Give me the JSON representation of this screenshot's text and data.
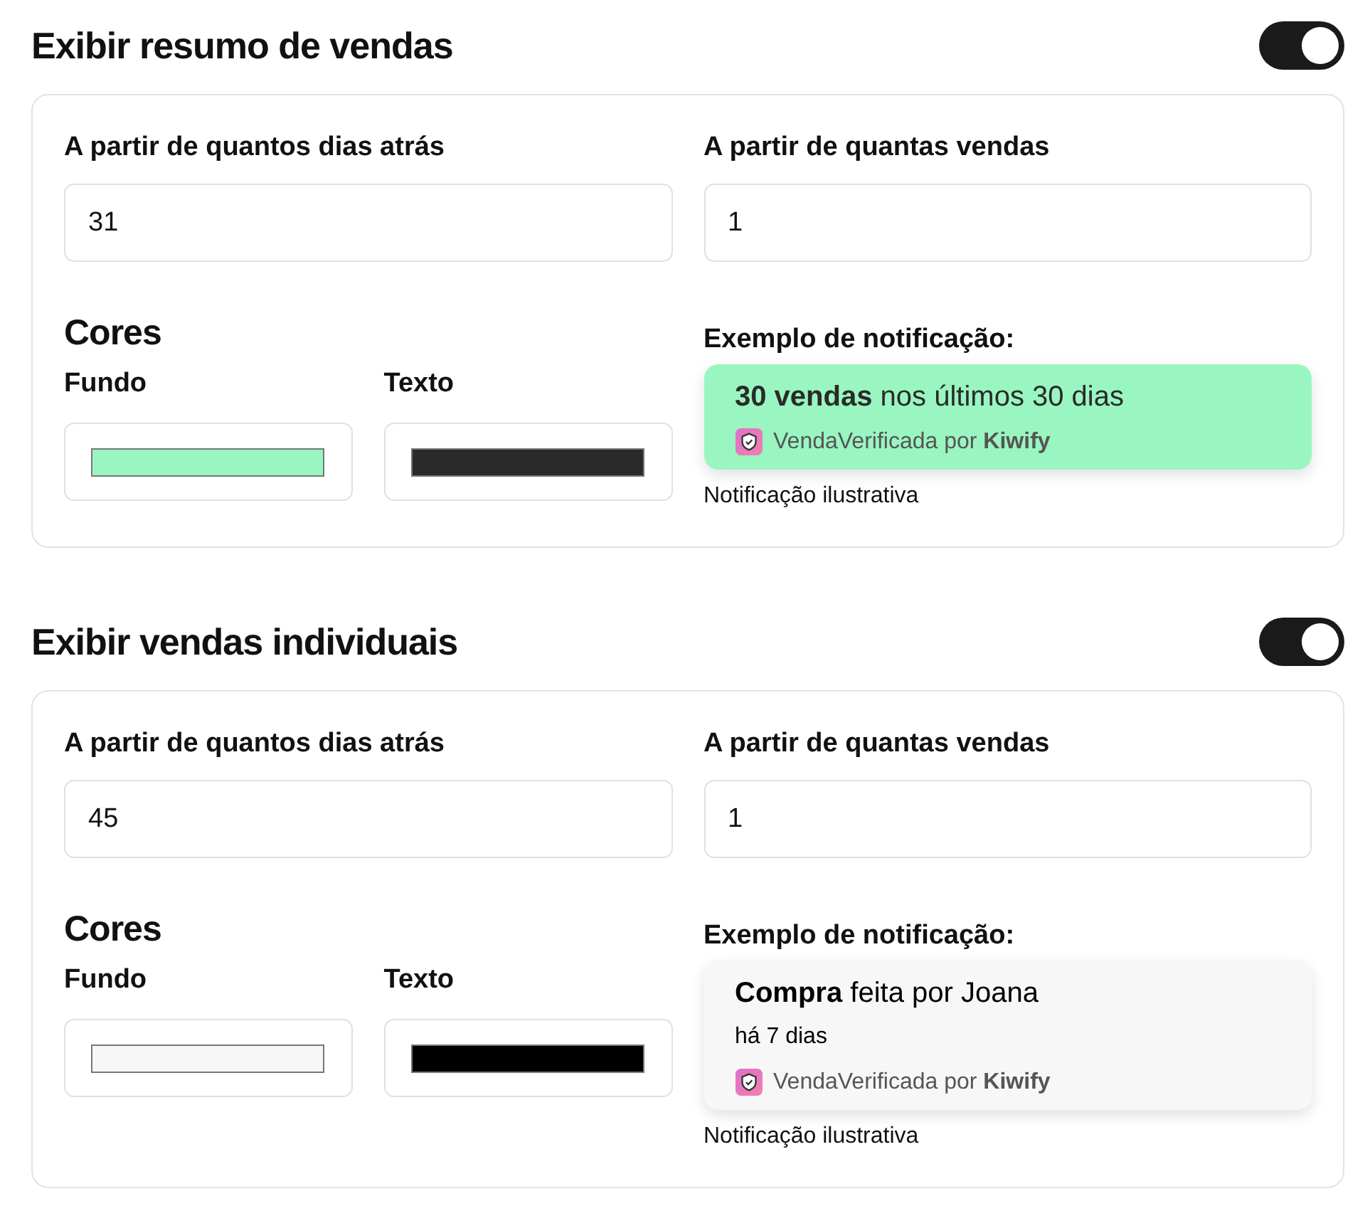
{
  "sections": [
    {
      "title": "Exibir resumo de vendas",
      "on": true,
      "days_label": "A partir de quantos dias atrás",
      "days_value": "31",
      "sales_label": "A partir de quantas vendas",
      "sales_value": "1",
      "colors_title": "Cores",
      "swatches": [
        {
          "label": "Fundo",
          "color": "#99f6c0"
        },
        {
          "label": "Texto",
          "color": "#2a2a2a"
        }
      ],
      "example_label": "Exemplo de notificação:",
      "notification": {
        "headline": "**30 vendas** nos últimos 30 dias",
        "footer": "VendaVerificada por **Kiwify**"
      },
      "caption": "Notificação ilustrativa"
    },
    {
      "title": "Exibir vendas individuais",
      "on": true,
      "days_label": "A partir de quantos dias atrás",
      "days_value": "45",
      "sales_label": "A partir de quantas vendas",
      "sales_value": "1",
      "colors_title": "Cores",
      "swatches": [
        {
          "label": "Fundo",
          "color": "#f7f7f7"
        },
        {
          "label": "Texto",
          "color": "#000000"
        }
      ],
      "example_label": "Exemplo de notificação:",
      "notification": {
        "headline": "**Compra** feita por Joana",
        "subtitle": "há 7 dias",
        "footer": "VendaVerificada por **Kiwify**"
      },
      "caption": "Notificação ilustrativa"
    }
  ]
}
